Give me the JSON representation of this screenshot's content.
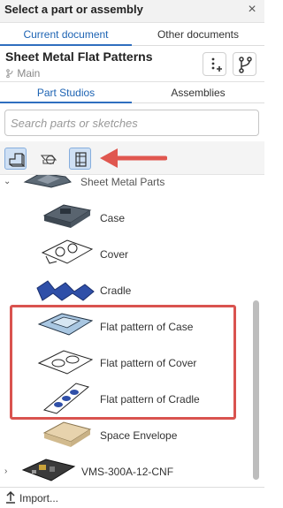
{
  "dialog": {
    "title": "Select a part or assembly",
    "close_symbol": "×"
  },
  "doc_tabs": {
    "current": "Current document",
    "other": "Other documents"
  },
  "document": {
    "name": "Sheet Metal Flat Patterns",
    "branch": "Main",
    "branch_icon": "branch-icon",
    "buttons": [
      "add-icon",
      "branch-icon"
    ]
  },
  "part_tabs": {
    "part_studios": "Part Studios",
    "assemblies": "Assemblies"
  },
  "search": {
    "placeholder": "Search parts or sketches"
  },
  "filters": [
    {
      "icon": "part-studio-filter-icon",
      "active": true
    },
    {
      "icon": "sketch-filter-icon",
      "active": false
    },
    {
      "icon": "assembly-filter-icon",
      "active": true
    }
  ],
  "tree": {
    "group": "Sheet Metal Parts",
    "items": [
      {
        "label": "Case",
        "thumb": "case-thumbnail"
      },
      {
        "label": "Cover",
        "thumb": "cover-thumbnail"
      },
      {
        "label": "Cradle",
        "thumb": "cradle-thumbnail"
      },
      {
        "label": "Flat pattern of Case",
        "thumb": "flat-case-thumbnail"
      },
      {
        "label": "Flat pattern of Cover",
        "thumb": "flat-cover-thumbnail"
      },
      {
        "label": "Flat pattern of Cradle",
        "thumb": "flat-cradle-thumbnail"
      },
      {
        "label": "Space Envelope",
        "thumb": "space-envelope-thumbnail"
      }
    ],
    "next_group": "VMS-300A-12-CNF"
  },
  "footer": {
    "import_label": "Import..."
  },
  "colors": {
    "accent": "#1d63b3",
    "highlight": "#d9534f",
    "arrow": "#e0574f"
  }
}
